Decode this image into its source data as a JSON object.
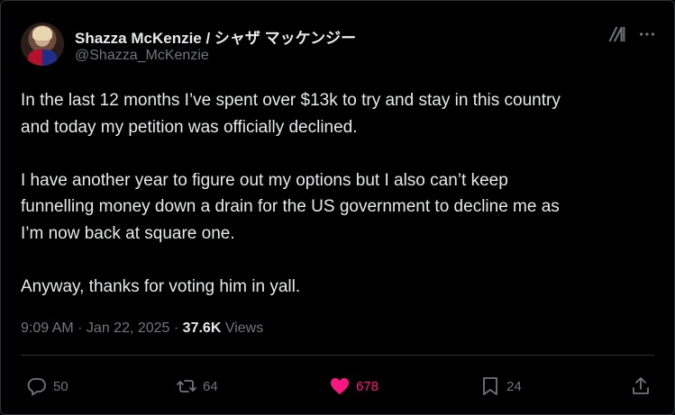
{
  "author": {
    "display_name": "Shazza McKenzie / シャザ マッケンジー",
    "handle": "@Shazza_McKenzie"
  },
  "tweet": {
    "lines": [
      "In the last 12 months I’ve spent over $13k to try and stay in this country",
      "and today my petition was officially declined.",
      "I have another year to figure out my options but I also can’t keep",
      "funnelling money down a drain for the US government to decline me as",
      "I’m now back at square one.",
      "Anyway, thanks for voting him in yall."
    ]
  },
  "meta": {
    "time": "9:09 AM",
    "separator1": " · ",
    "date": "Jan 22, 2025",
    "separator2": " · ",
    "views_count": "37.6K",
    "views_label": " Views"
  },
  "actions": {
    "reply_count": "50",
    "repost_count": "64",
    "like_count": "678",
    "bookmark_count": "24"
  },
  "icons": {
    "header": [
      "grok-icon",
      "more-icon"
    ],
    "actions": [
      "reply-icon",
      "repost-icon",
      "like-icon",
      "bookmark-icon",
      "share-icon"
    ]
  },
  "colors": {
    "background": "#000000",
    "text": "#e7e9ea",
    "secondary": "#71767b",
    "like": "#f91880",
    "border": "#2f3336"
  }
}
